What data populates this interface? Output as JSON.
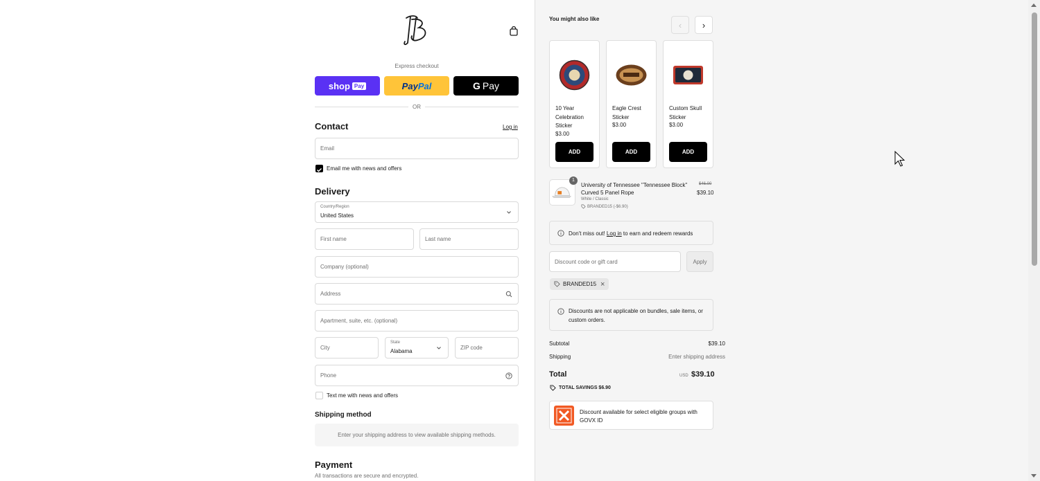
{
  "header": {
    "logo_icon": "brand-monogram-icon",
    "cart_icon": "shopping-bag-icon"
  },
  "express": {
    "label": "Express checkout",
    "shop_pay_word": "shop",
    "shop_pay_tag": "Pay",
    "paypal_pay": "Pay",
    "paypal_pal": "Pal",
    "gpay_g": "G",
    "gpay_word": "Pay",
    "or": "OR"
  },
  "contact": {
    "title": "Contact",
    "login": "Log in",
    "email_placeholder": "Email",
    "newsletter_label": "Email me with news and offers",
    "newsletter_checked": true
  },
  "delivery": {
    "title": "Delivery",
    "country_label": "Country/Region",
    "country_value": "United States",
    "first_name": "First name",
    "last_name": "Last name",
    "company": "Company (optional)",
    "address": "Address",
    "apartment": "Apartment, suite, etc. (optional)",
    "city": "City",
    "state_label": "State",
    "state_value": "Alabama",
    "zip": "ZIP code",
    "phone": "Phone",
    "sms_label": "Text me with news and offers",
    "sms_checked": false
  },
  "shipping": {
    "title": "Shipping method",
    "notice": "Enter your shipping address to view available shipping methods."
  },
  "payment": {
    "title": "Payment",
    "subtitle": "All transactions are secure and encrypted."
  },
  "upsell": {
    "title": "You might also like",
    "prev": "‹",
    "next": "›",
    "products": [
      {
        "name": "10 Year Celebration Sticker",
        "price": "$3.00",
        "button": "ADD"
      },
      {
        "name": "Eagle Crest Sticker",
        "price": "$3.00",
        "button": "ADD"
      },
      {
        "name": "Custom Skull Sticker",
        "price": "$3.00",
        "button": "ADD"
      }
    ]
  },
  "cart_item": {
    "quantity": "1",
    "name": "University of Tennessee \"Tennessee Block\" Curved 5 Panel Rope",
    "variant": "White / Classic",
    "discount": "BRANDED15 (-$6.90)",
    "original_price": "$46.00",
    "price": "$39.10"
  },
  "rewards": {
    "prefix": "Don't miss out!",
    "link": "Log in",
    "suffix": "to earn and redeem rewards"
  },
  "discount": {
    "placeholder": "Discount code or gift card",
    "apply": "Apply",
    "applied_code": "BRANDED15",
    "remove": "×",
    "notice": "Discounts are not applicable on bundles, sale items, or custom orders."
  },
  "summary": {
    "subtotal_label": "Subtotal",
    "subtotal_value": "$39.10",
    "shipping_label": "Shipping",
    "shipping_value": "Enter shipping address",
    "total_label": "Total",
    "currency": "USD",
    "total_value": "$39.10",
    "savings": "TOTAL SAVINGS  $6.90"
  },
  "govx": {
    "text": "Discount available for select eligible groups with GOVX ID"
  },
  "colors": {
    "shop_pay": "#5a31f4",
    "paypal": "#ffc439",
    "govx": "#f15a24"
  }
}
